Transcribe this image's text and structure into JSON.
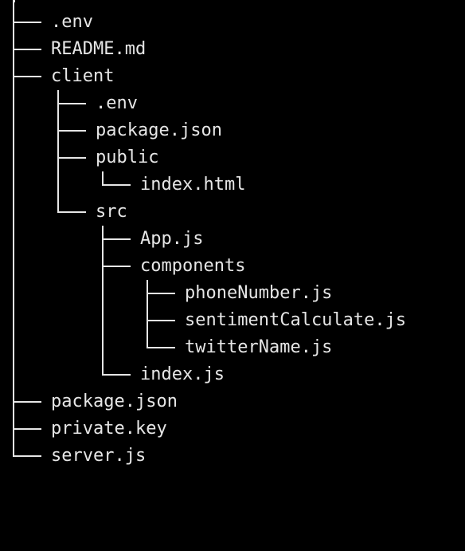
{
  "theme": {
    "background": "#000000",
    "text": "#e6e6e6",
    "lines": "#e6e6e6"
  },
  "tree": {
    "root": ".",
    "items": [
      {
        "label": ".env"
      },
      {
        "label": "README.md"
      },
      {
        "label": "client"
      },
      {
        "label": ".env"
      },
      {
        "label": "package.json"
      },
      {
        "label": "public"
      },
      {
        "label": "index.html"
      },
      {
        "label": "src"
      },
      {
        "label": "App.js"
      },
      {
        "label": "components"
      },
      {
        "label": "phoneNumber.js"
      },
      {
        "label": "sentimentCalculate.js"
      },
      {
        "label": "twitterName.js"
      },
      {
        "label": "index.js"
      },
      {
        "label": "package.json"
      },
      {
        "label": "private.key"
      },
      {
        "label": "server.js"
      }
    ]
  }
}
